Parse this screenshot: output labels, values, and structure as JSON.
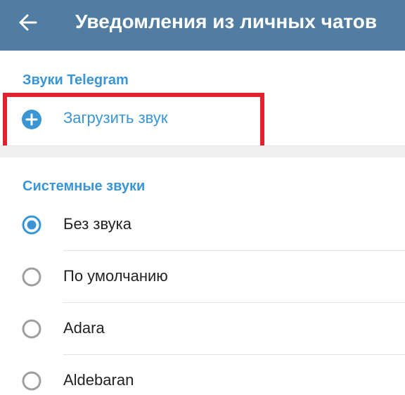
{
  "header": {
    "title": "Уведомления из личных чатов",
    "back_icon": "arrow-left-icon"
  },
  "telegram_sounds": {
    "section_title": "Звуки Telegram",
    "upload_label": "Загрузить звук",
    "upload_icon": "plus-circle-icon"
  },
  "system_sounds": {
    "section_title": "Системные звуки",
    "items": [
      {
        "label": "Без звука",
        "selected": true
      },
      {
        "label": "По умолчанию",
        "selected": false
      },
      {
        "label": "Adara",
        "selected": false
      },
      {
        "label": "Aldebaran",
        "selected": false
      }
    ]
  },
  "colors": {
    "appbar": "#517da2",
    "accent": "#3a95d5",
    "highlight": "#e0222e",
    "radio_unselected": "#9e9e9e"
  }
}
